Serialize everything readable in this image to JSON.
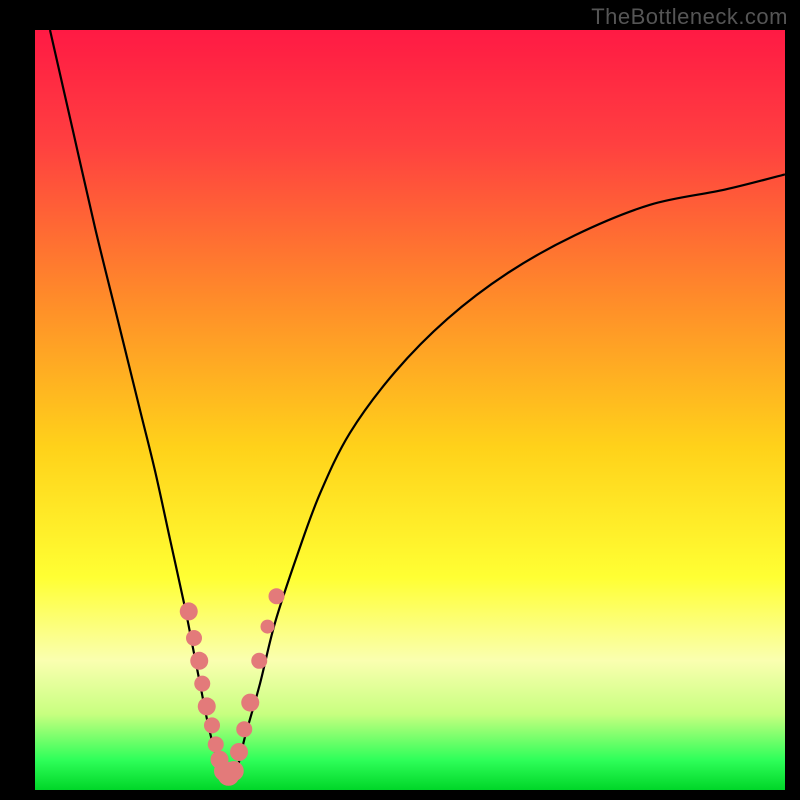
{
  "watermark": "TheBottleneck.com",
  "plot": {
    "inner_left": 35,
    "inner_top": 30,
    "inner_width": 750,
    "inner_height": 760
  },
  "gradient": {
    "stops": [
      {
        "offset": 0.0,
        "color": "#ff1a44"
      },
      {
        "offset": 0.15,
        "color": "#ff4040"
      },
      {
        "offset": 0.35,
        "color": "#ff8a2a"
      },
      {
        "offset": 0.55,
        "color": "#ffd21a"
      },
      {
        "offset": 0.72,
        "color": "#ffff33"
      },
      {
        "offset": 0.83,
        "color": "#faffb0"
      },
      {
        "offset": 0.9,
        "color": "#c8ff80"
      },
      {
        "offset": 0.96,
        "color": "#2fff5a"
      },
      {
        "offset": 1.0,
        "color": "#00d628"
      }
    ]
  },
  "chart_data": {
    "type": "line",
    "title": "",
    "xlabel": "",
    "ylabel": "",
    "xlim": [
      0,
      100
    ],
    "ylim": [
      0,
      100
    ],
    "series": [
      {
        "name": "bottleneck-curve",
        "x": [
          2,
          5,
          8,
          11,
          14,
          16,
          18,
          20,
          21,
          22,
          23,
          24,
          25,
          26,
          27,
          28,
          30,
          32,
          35,
          38,
          42,
          48,
          55,
          63,
          72,
          82,
          92,
          100
        ],
        "y": [
          100,
          87,
          74,
          62,
          50,
          42,
          33,
          24,
          19,
          14,
          9,
          5,
          2,
          1,
          3,
          7,
          14,
          22,
          31,
          39,
          47,
          55,
          62,
          68,
          73,
          77,
          79,
          81
        ]
      }
    ],
    "markers": {
      "name": "highlight-dots",
      "x": [
        20.5,
        21.2,
        21.9,
        22.3,
        22.9,
        23.6,
        24.1,
        24.6,
        25.2,
        25.8,
        26.5,
        27.2,
        27.9,
        28.7,
        29.9,
        31.0,
        32.2
      ],
      "y": [
        23.5,
        20.0,
        17.0,
        14.0,
        11.0,
        8.5,
        6.0,
        4.0,
        2.5,
        2.0,
        2.5,
        5.0,
        8.0,
        11.5,
        17.0,
        21.5,
        25.5
      ],
      "r": [
        9,
        8,
        9,
        8,
        9,
        8,
        8,
        9,
        10,
        11,
        10,
        9,
        8,
        9,
        8,
        7,
        8
      ]
    }
  }
}
